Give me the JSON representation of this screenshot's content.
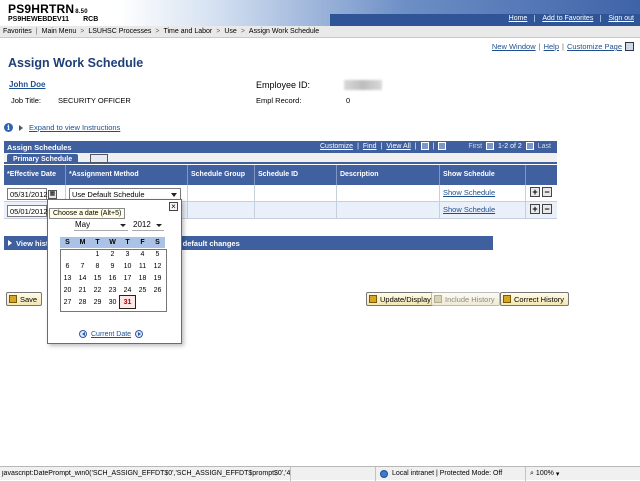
{
  "header": {
    "title": "PS9HRTRN",
    "version": "8.50",
    "db": "PS9HEWEBDEV11",
    "user": "RCB",
    "links": [
      "Home",
      "Add to Favorites",
      "Sign out"
    ]
  },
  "breadcrumb": [
    "Favorites",
    "Main Menu",
    "LSUHSC Processes",
    "Time and Labor",
    "Use",
    "Assign Work Schedule"
  ],
  "page_links": [
    "New Window",
    "Help",
    "Customize Page"
  ],
  "page_title": "Assign Work Schedule",
  "employee": {
    "name": "John Doe",
    "id_label": "Employee ID:",
    "job_title_label": "Job Title:",
    "job_title": "SECURITY OFFICER",
    "empl_record_label": "Empl Record:",
    "empl_record": "0"
  },
  "expand_instructions": "Expand to view Instructions",
  "grid": {
    "title": "Assign Schedules",
    "tools": {
      "customize": "Customize",
      "find": "Find",
      "view_all": "View All",
      "first": "First",
      "range": "1-2 of 2",
      "last": "Last"
    },
    "tab": "Primary Schedule",
    "columns": [
      "*Effective Date",
      "*Assignment Method",
      "Schedule Group",
      "Schedule ID",
      "Description",
      "Show Schedule"
    ],
    "rows": [
      {
        "date": "05/31/2012",
        "method": "Use Default Schedule",
        "show": "Show Schedule"
      },
      {
        "date": "05/01/2012",
        "method": "",
        "show": "Show Schedule"
      }
    ]
  },
  "history_bar": {
    "lead": "View hist",
    "tail": "g default changes"
  },
  "buttons": {
    "save": "Save",
    "update_display": "Update/Display",
    "include_history": "Include History",
    "correct_history": "Correct History"
  },
  "calendar": {
    "tooltip": "Choose a date (Alt+5)",
    "month": "May",
    "year": "2012",
    "days_of_week": [
      "S",
      "M",
      "T",
      "W",
      "T",
      "F",
      "S"
    ],
    "weeks": [
      [
        "",
        "",
        "1",
        "2",
        "3",
        "4",
        "5"
      ],
      [
        "6",
        "7",
        "8",
        "9",
        "10",
        "11",
        "12"
      ],
      [
        "13",
        "14",
        "15",
        "16",
        "17",
        "18",
        "19"
      ],
      [
        "20",
        "21",
        "22",
        "23",
        "24",
        "25",
        "26"
      ],
      [
        "27",
        "28",
        "29",
        "30",
        "31",
        "",
        ""
      ]
    ],
    "selected_day": "31",
    "footer": "Current Date"
  },
  "status_bar": {
    "text": "javascript:DatePrompt_win0('SCH_ASSIGN_EFFDT$0','SCH_ASSIGN_EFFDT$prompt$0','4!",
    "zone": "Local intranet | Protected Mode: Off",
    "zoom": "100%"
  }
}
